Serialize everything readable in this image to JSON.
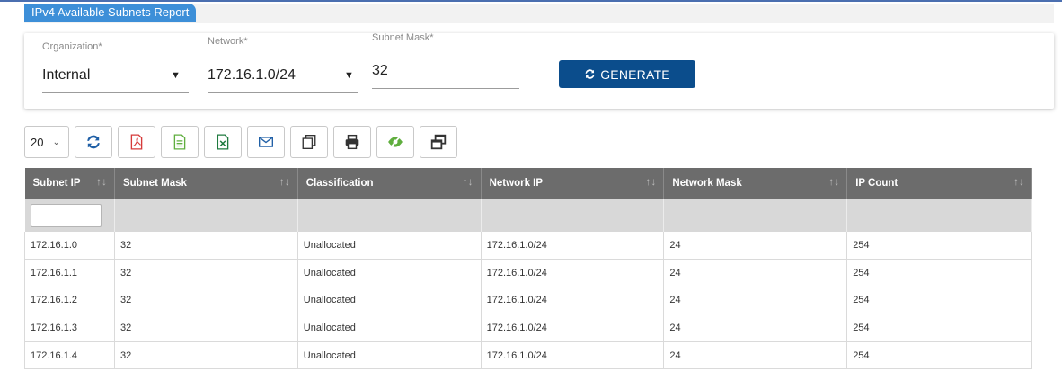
{
  "report": {
    "title": "IPv4 Available Subnets Report"
  },
  "form": {
    "organization": {
      "label": "Organization*",
      "value": "Internal"
    },
    "network": {
      "label": "Network*",
      "value": "172.16.1.0/24"
    },
    "subnet_mask": {
      "label": "Subnet Mask*",
      "value": "32"
    },
    "generate_label": "GENERATE"
  },
  "toolbar": {
    "page_size": "20",
    "icons": [
      "refresh-icon",
      "pdf-icon",
      "csv-icon",
      "excel-icon",
      "email-icon",
      "copy-icon",
      "print-icon",
      "column-visibility-icon",
      "restore-columns-icon"
    ]
  },
  "colors": {
    "primary": "#0b4d8c",
    "tab": "#3d8fd8",
    "header": "#6c6c6c",
    "pdf": "#d63a3a",
    "csv": "#5fae3e",
    "excel": "#1e7a3e",
    "email": "#1f5fa6",
    "visibility": "#5fae3e"
  },
  "table": {
    "columns": [
      "Subnet IP",
      "Subnet Mask",
      "Classification",
      "Network IP",
      "Network Mask",
      "IP Count"
    ],
    "rows": [
      [
        "172.16.1.0",
        "32",
        "Unallocated",
        "172.16.1.0/24",
        "24",
        "254"
      ],
      [
        "172.16.1.1",
        "32",
        "Unallocated",
        "172.16.1.0/24",
        "24",
        "254"
      ],
      [
        "172.16.1.2",
        "32",
        "Unallocated",
        "172.16.1.0/24",
        "24",
        "254"
      ],
      [
        "172.16.1.3",
        "32",
        "Unallocated",
        "172.16.1.0/24",
        "24",
        "254"
      ],
      [
        "172.16.1.4",
        "32",
        "Unallocated",
        "172.16.1.0/24",
        "24",
        "254"
      ]
    ]
  }
}
